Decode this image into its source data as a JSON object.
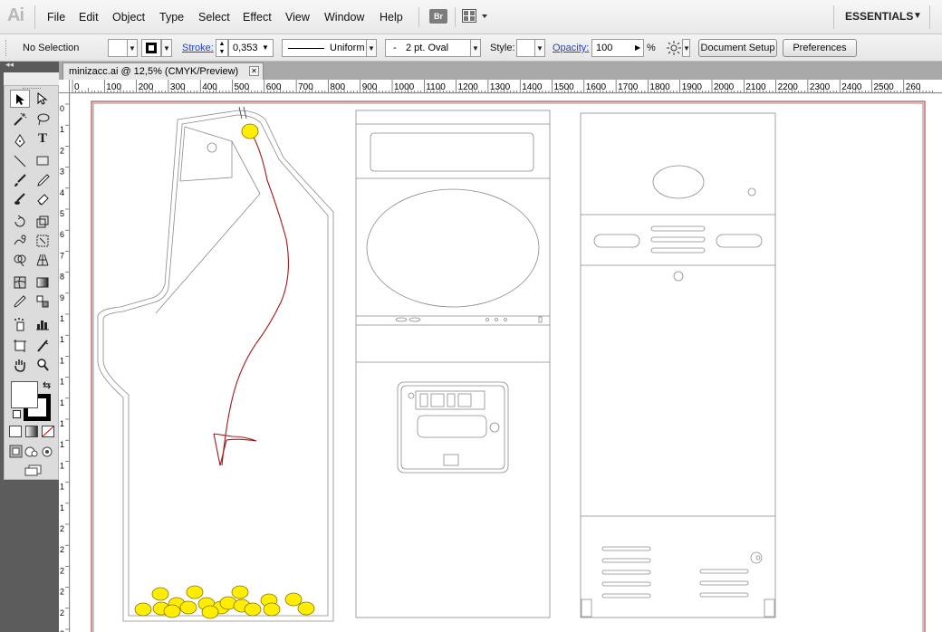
{
  "app": {
    "logo": "Ai"
  },
  "menu": [
    "File",
    "Edit",
    "Object",
    "Type",
    "Select",
    "Effect",
    "View",
    "Window",
    "Help"
  ],
  "bridge_button": "Br",
  "workspace": {
    "label": "ESSENTIALS"
  },
  "control": {
    "selection_status": "No Selection",
    "stroke_label": "Stroke:",
    "stroke_value": "0,353",
    "profile": "Uniform",
    "brush": "2 pt. Oval",
    "brush_prefix": "-",
    "style_label": "Style:",
    "opacity_label": "Opacity:",
    "opacity_value": "100",
    "opacity_unit": "%",
    "document_setup": "Document Setup",
    "preferences": "Preferences"
  },
  "document": {
    "tab_title": "minizacc.ai @ 12,5% (CMYK/Preview)"
  },
  "ruler": {
    "h_labels": [
      "0",
      "100",
      "200",
      "300",
      "400",
      "500",
      "600",
      "700",
      "800",
      "900",
      "1000",
      "1100",
      "1200",
      "1300",
      "1400",
      "1500",
      "1600",
      "1700",
      "1800",
      "1900",
      "2000",
      "2100",
      "2200",
      "2300",
      "2400",
      "2500",
      "260"
    ],
    "v_labels": [
      "0",
      "1",
      "2",
      "3",
      "4",
      "5",
      "6",
      "7",
      "8",
      "9",
      "1",
      "1",
      "1",
      "1",
      "1",
      "1",
      "1",
      "1",
      "1",
      "1",
      "2",
      "2",
      "2",
      "2",
      "2",
      "2",
      "2"
    ]
  },
  "tools": [
    "selection-tool",
    "direct-selection-tool",
    "magic-wand-tool",
    "lasso-tool",
    "pen-tool",
    "type-tool",
    "line-segment-tool",
    "rectangle-tool",
    "paintbrush-tool",
    "pencil-tool",
    "blob-brush-tool",
    "eraser-tool",
    "rotate-tool",
    "scale-tool",
    "warp-tool",
    "free-transform-tool",
    "shape-builder-tool",
    "perspective-grid-tool",
    "mesh-tool",
    "gradient-tool",
    "eyedropper-tool",
    "blend-tool",
    "symbol-sprayer-tool",
    "column-graph-tool",
    "artboard-tool",
    "slice-tool",
    "hand-tool",
    "zoom-tool"
  ],
  "colors": {
    "artboard_border": "#a02020",
    "coin_fill": "#ffee00",
    "path_red": "#a31818",
    "outline_gray": "#8a8a8a"
  }
}
